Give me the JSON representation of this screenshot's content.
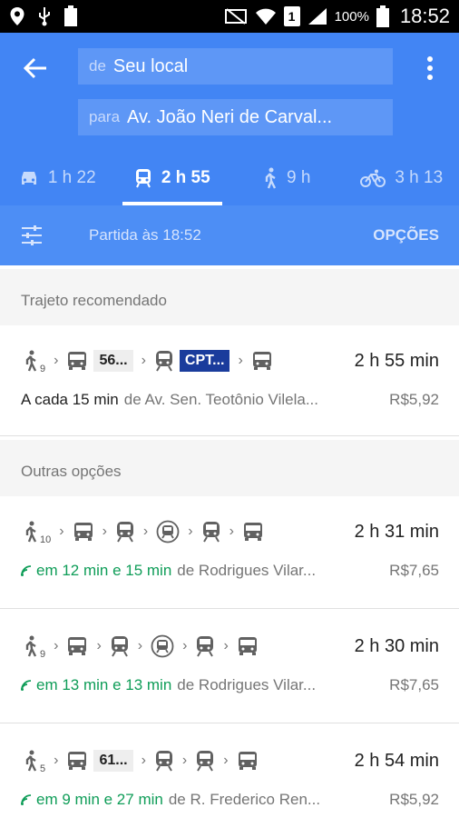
{
  "status_bar": {
    "battery_percent": "100%",
    "time": "18:52",
    "sim": "1"
  },
  "search": {
    "from_prefix": "de",
    "from_value": "Seu local",
    "to_prefix": "para",
    "to_value": "Av. João Neri de Carval..."
  },
  "modes": [
    {
      "icon": "car-icon",
      "label": "1 h 22"
    },
    {
      "icon": "transit-icon",
      "label": "2 h 55"
    },
    {
      "icon": "walk-icon",
      "label": "9 h"
    },
    {
      "icon": "bike-icon",
      "label": "3 h 13"
    }
  ],
  "options_bar": {
    "departure": "Partida às 18:52",
    "options_label": "OPÇÕES"
  },
  "recommended": {
    "title": "Trajeto recomendado",
    "walk_minutes": "9",
    "chip1": "56...",
    "chip2": "CPT...",
    "duration": "2 h 55 min",
    "frequency": "A cada 15 min",
    "from": "de Av. Sen. Teotônio Vilela...",
    "price": "R$5,92"
  },
  "others_title": "Outras opções",
  "others": [
    {
      "walk_minutes": "10",
      "duration": "2 h 31 min",
      "realtime": "em 12 min e 15 min",
      "from": "de Rodrigues Vilar...",
      "price": "R$7,65"
    },
    {
      "walk_minutes": "9",
      "duration": "2 h 30 min",
      "realtime": "em 13 min e 13 min",
      "from": "de Rodrigues Vilar...",
      "price": "R$7,65"
    },
    {
      "walk_minutes": "5",
      "chip": "61...",
      "duration": "2 h 54 min",
      "realtime": "em 9 min e 27 min",
      "from": "de R. Frederico Ren...",
      "price": "R$5,92"
    }
  ],
  "colors": {
    "header_blue": "#4285f4",
    "realtime_green": "#0f9d58",
    "chip_blue": "#1a3c9c"
  }
}
